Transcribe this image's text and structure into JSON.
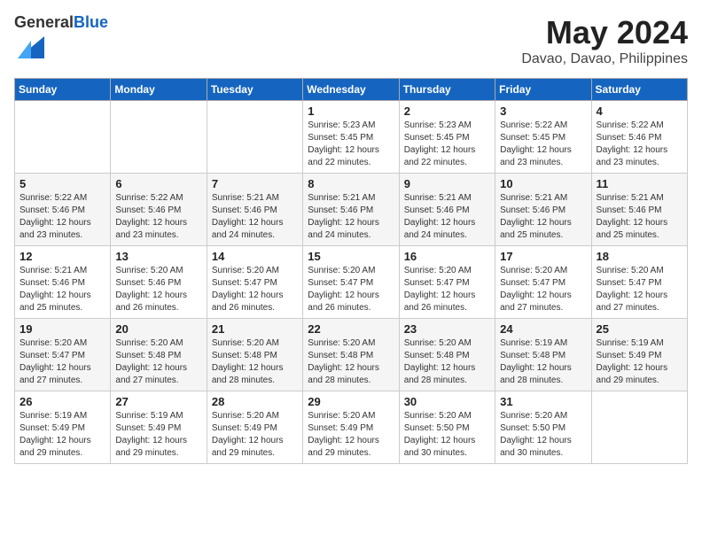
{
  "header": {
    "logo_general": "General",
    "logo_blue": "Blue",
    "title": "May 2024",
    "location": "Davao, Davao, Philippines"
  },
  "calendar": {
    "weekdays": [
      "Sunday",
      "Monday",
      "Tuesday",
      "Wednesday",
      "Thursday",
      "Friday",
      "Saturday"
    ],
    "weeks": [
      [
        {
          "day": "",
          "info": ""
        },
        {
          "day": "",
          "info": ""
        },
        {
          "day": "",
          "info": ""
        },
        {
          "day": "1",
          "info": "Sunrise: 5:23 AM\nSunset: 5:45 PM\nDaylight: 12 hours\nand 22 minutes."
        },
        {
          "day": "2",
          "info": "Sunrise: 5:23 AM\nSunset: 5:45 PM\nDaylight: 12 hours\nand 22 minutes."
        },
        {
          "day": "3",
          "info": "Sunrise: 5:22 AM\nSunset: 5:45 PM\nDaylight: 12 hours\nand 23 minutes."
        },
        {
          "day": "4",
          "info": "Sunrise: 5:22 AM\nSunset: 5:46 PM\nDaylight: 12 hours\nand 23 minutes."
        }
      ],
      [
        {
          "day": "5",
          "info": "Sunrise: 5:22 AM\nSunset: 5:46 PM\nDaylight: 12 hours\nand 23 minutes."
        },
        {
          "day": "6",
          "info": "Sunrise: 5:22 AM\nSunset: 5:46 PM\nDaylight: 12 hours\nand 23 minutes."
        },
        {
          "day": "7",
          "info": "Sunrise: 5:21 AM\nSunset: 5:46 PM\nDaylight: 12 hours\nand 24 minutes."
        },
        {
          "day": "8",
          "info": "Sunrise: 5:21 AM\nSunset: 5:46 PM\nDaylight: 12 hours\nand 24 minutes."
        },
        {
          "day": "9",
          "info": "Sunrise: 5:21 AM\nSunset: 5:46 PM\nDaylight: 12 hours\nand 24 minutes."
        },
        {
          "day": "10",
          "info": "Sunrise: 5:21 AM\nSunset: 5:46 PM\nDaylight: 12 hours\nand 25 minutes."
        },
        {
          "day": "11",
          "info": "Sunrise: 5:21 AM\nSunset: 5:46 PM\nDaylight: 12 hours\nand 25 minutes."
        }
      ],
      [
        {
          "day": "12",
          "info": "Sunrise: 5:21 AM\nSunset: 5:46 PM\nDaylight: 12 hours\nand 25 minutes."
        },
        {
          "day": "13",
          "info": "Sunrise: 5:20 AM\nSunset: 5:46 PM\nDaylight: 12 hours\nand 26 minutes."
        },
        {
          "day": "14",
          "info": "Sunrise: 5:20 AM\nSunset: 5:47 PM\nDaylight: 12 hours\nand 26 minutes."
        },
        {
          "day": "15",
          "info": "Sunrise: 5:20 AM\nSunset: 5:47 PM\nDaylight: 12 hours\nand 26 minutes."
        },
        {
          "day": "16",
          "info": "Sunrise: 5:20 AM\nSunset: 5:47 PM\nDaylight: 12 hours\nand 26 minutes."
        },
        {
          "day": "17",
          "info": "Sunrise: 5:20 AM\nSunset: 5:47 PM\nDaylight: 12 hours\nand 27 minutes."
        },
        {
          "day": "18",
          "info": "Sunrise: 5:20 AM\nSunset: 5:47 PM\nDaylight: 12 hours\nand 27 minutes."
        }
      ],
      [
        {
          "day": "19",
          "info": "Sunrise: 5:20 AM\nSunset: 5:47 PM\nDaylight: 12 hours\nand 27 minutes."
        },
        {
          "day": "20",
          "info": "Sunrise: 5:20 AM\nSunset: 5:48 PM\nDaylight: 12 hours\nand 27 minutes."
        },
        {
          "day": "21",
          "info": "Sunrise: 5:20 AM\nSunset: 5:48 PM\nDaylight: 12 hours\nand 28 minutes."
        },
        {
          "day": "22",
          "info": "Sunrise: 5:20 AM\nSunset: 5:48 PM\nDaylight: 12 hours\nand 28 minutes."
        },
        {
          "day": "23",
          "info": "Sunrise: 5:20 AM\nSunset: 5:48 PM\nDaylight: 12 hours\nand 28 minutes."
        },
        {
          "day": "24",
          "info": "Sunrise: 5:19 AM\nSunset: 5:48 PM\nDaylight: 12 hours\nand 28 minutes."
        },
        {
          "day": "25",
          "info": "Sunrise: 5:19 AM\nSunset: 5:49 PM\nDaylight: 12 hours\nand 29 minutes."
        }
      ],
      [
        {
          "day": "26",
          "info": "Sunrise: 5:19 AM\nSunset: 5:49 PM\nDaylight: 12 hours\nand 29 minutes."
        },
        {
          "day": "27",
          "info": "Sunrise: 5:19 AM\nSunset: 5:49 PM\nDaylight: 12 hours\nand 29 minutes."
        },
        {
          "day": "28",
          "info": "Sunrise: 5:20 AM\nSunset: 5:49 PM\nDaylight: 12 hours\nand 29 minutes."
        },
        {
          "day": "29",
          "info": "Sunrise: 5:20 AM\nSunset: 5:49 PM\nDaylight: 12 hours\nand 29 minutes."
        },
        {
          "day": "30",
          "info": "Sunrise: 5:20 AM\nSunset: 5:50 PM\nDaylight: 12 hours\nand 30 minutes."
        },
        {
          "day": "31",
          "info": "Sunrise: 5:20 AM\nSunset: 5:50 PM\nDaylight: 12 hours\nand 30 minutes."
        },
        {
          "day": "",
          "info": ""
        }
      ]
    ]
  }
}
